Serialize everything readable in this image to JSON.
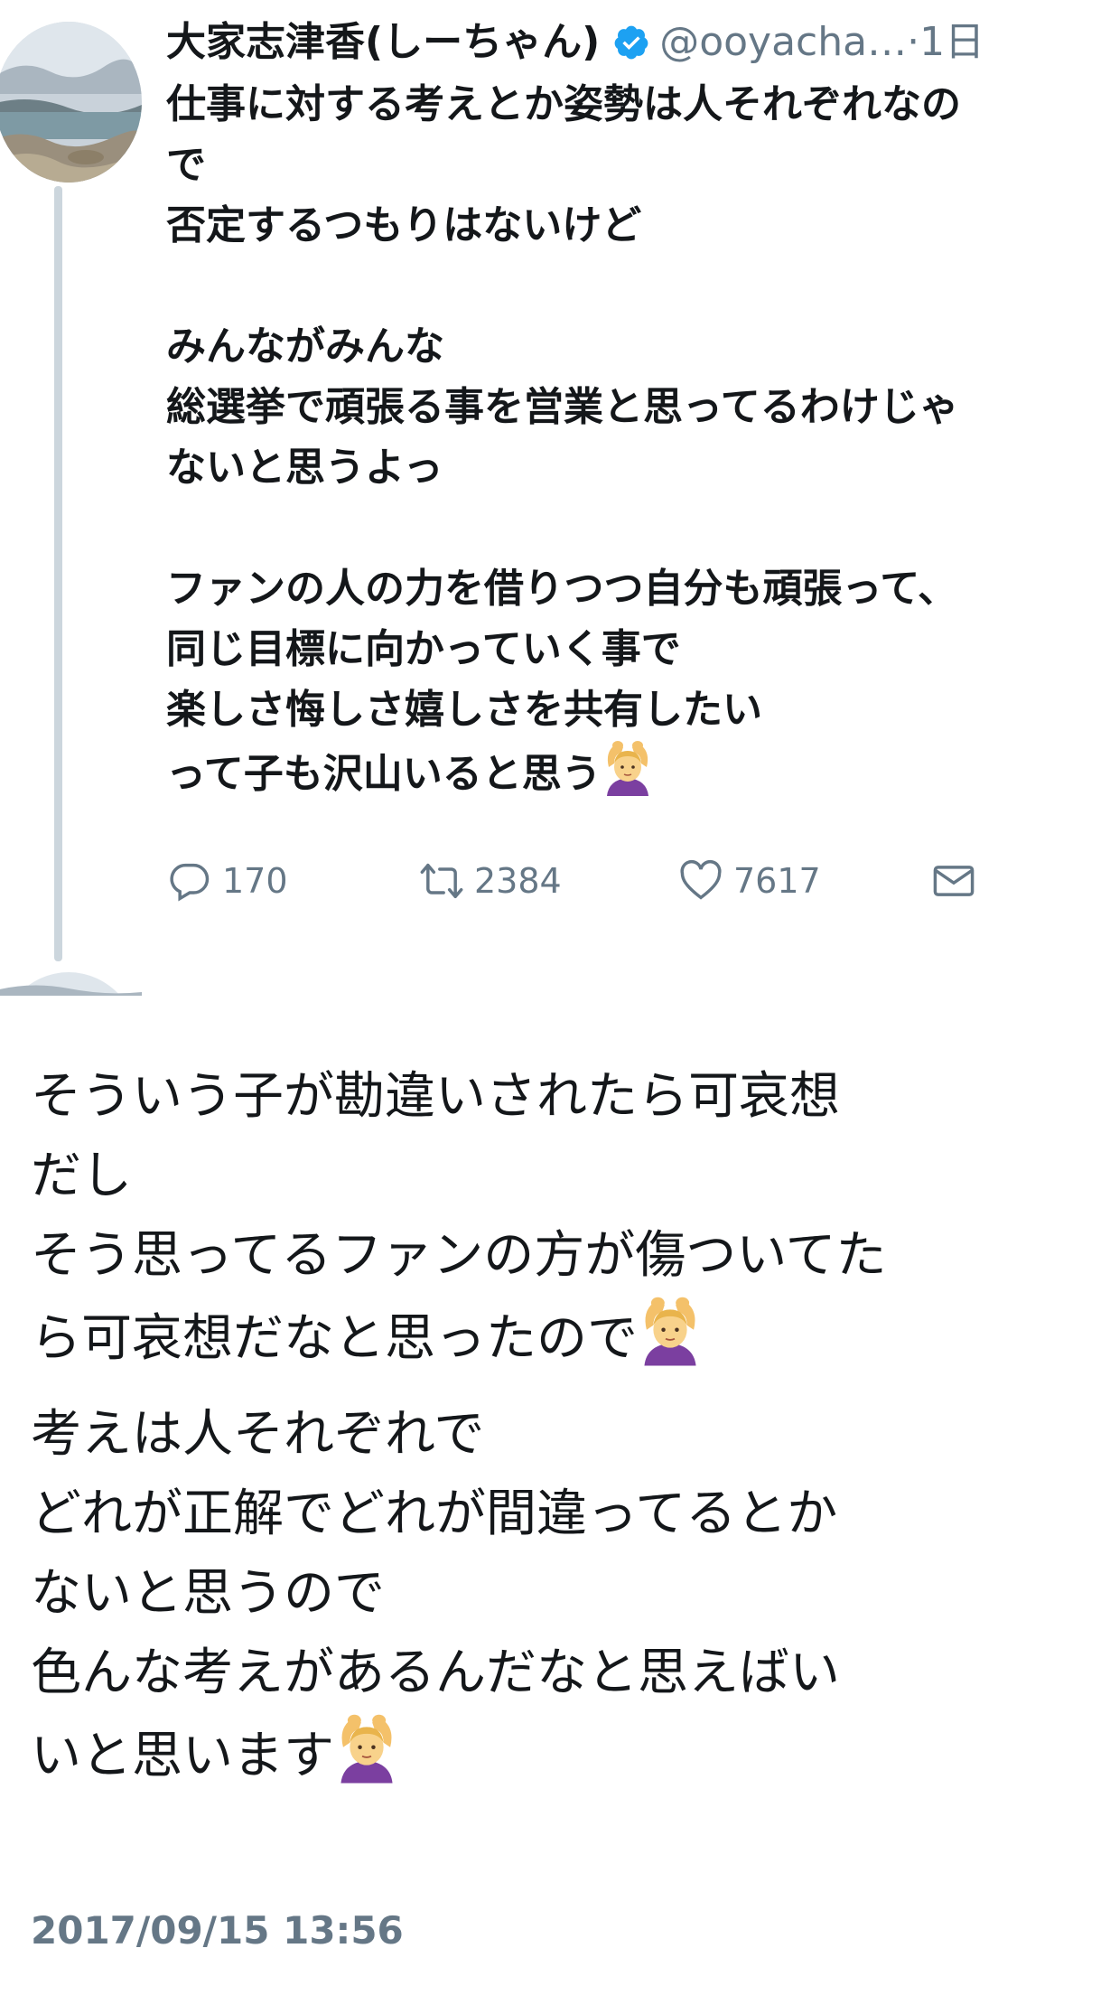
{
  "tweet": {
    "display_name": "大家志津香(しーちゃん)",
    "handle": "@ooyacha…",
    "separator": "·",
    "time": "1日",
    "lines": [
      "仕事に対する考えとか姿勢は人それぞれなの",
      "で",
      "否定するつもりはないけど",
      "",
      "みんながみんな",
      "総選挙で頑張る事を営業と思ってるわけじゃ",
      "ないと思うよっ",
      "",
      "ファンの人の力を借りつつ自分も頑張って、",
      "同じ目標に向かっていく事で",
      "楽しさ悔しさ嬉しさを共有したい",
      "って子も沢山いると思う"
    ],
    "actions": {
      "reply_count": "170",
      "retweet_count": "2384",
      "like_count": "7617"
    },
    "icons": {
      "verified": "verified-badge-icon",
      "reply": "reply-icon",
      "retweet": "retweet-icon",
      "like": "heart-icon",
      "dm": "envelope-icon",
      "emoji": "person-gesturing-ok-emoji"
    },
    "colors": {
      "accent": "#1da1f2",
      "muted": "#657786",
      "text": "#14171a",
      "thread": "#ccd6dd"
    }
  },
  "reply": {
    "paragraphs": [
      [
        "そういう子が勘違いされたら可哀想",
        "だし",
        "そう思ってるファンの方が傷ついてた",
        "ら可哀想だなと思ったので"
      ],
      [
        "考えは人それぞれで",
        "どれが正解でどれが間違ってるとか",
        "ないと思うので",
        "色んな考えがあるんだなと思えばい",
        "いと思います"
      ]
    ],
    "timestamp": "2017/09/15 13:56"
  }
}
